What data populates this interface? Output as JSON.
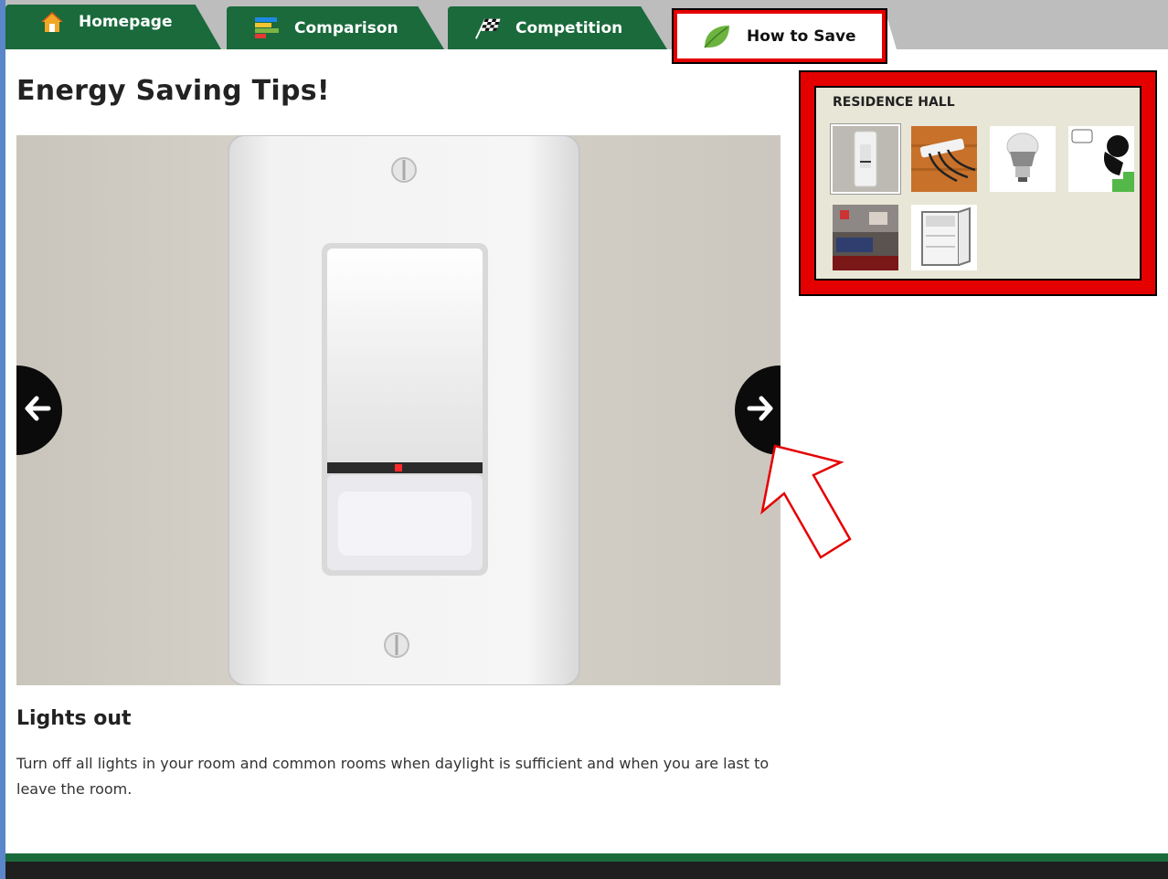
{
  "tabs": [
    {
      "label": "Homepage",
      "icon": "house-icon"
    },
    {
      "label": "Comparison",
      "icon": "bar-chart-icon"
    },
    {
      "label": "Competition",
      "icon": "checkered-flag-icon"
    },
    {
      "label": "How to Save",
      "icon": "leaf-icon",
      "active": true
    }
  ],
  "page": {
    "title": "Energy Saving Tips!"
  },
  "slideshow": {
    "prev_icon": "arrow-left-icon",
    "next_icon": "arrow-right-icon",
    "current_tip": {
      "title": "Lights out",
      "body": "Turn off all lights in your room and common rooms when daylight is sufficient and when you are last to leave the room.",
      "image": "occupancy-sensor-light-switch"
    }
  },
  "residence_hall": {
    "title": "RESIDENCE HALL",
    "thumbnails": [
      {
        "image": "light-switch",
        "selected": true
      },
      {
        "image": "power-strip",
        "selected": false
      },
      {
        "image": "led-bulb",
        "selected": false
      },
      {
        "image": "cartoon-take-stairs",
        "selected": false
      },
      {
        "image": "dorm-room",
        "selected": false
      },
      {
        "image": "mini-fridge",
        "selected": false
      }
    ]
  },
  "colors": {
    "tab_green": "#1a6a3c",
    "highlight_red": "#e50000",
    "panel_bg": "#e8e6d6"
  }
}
